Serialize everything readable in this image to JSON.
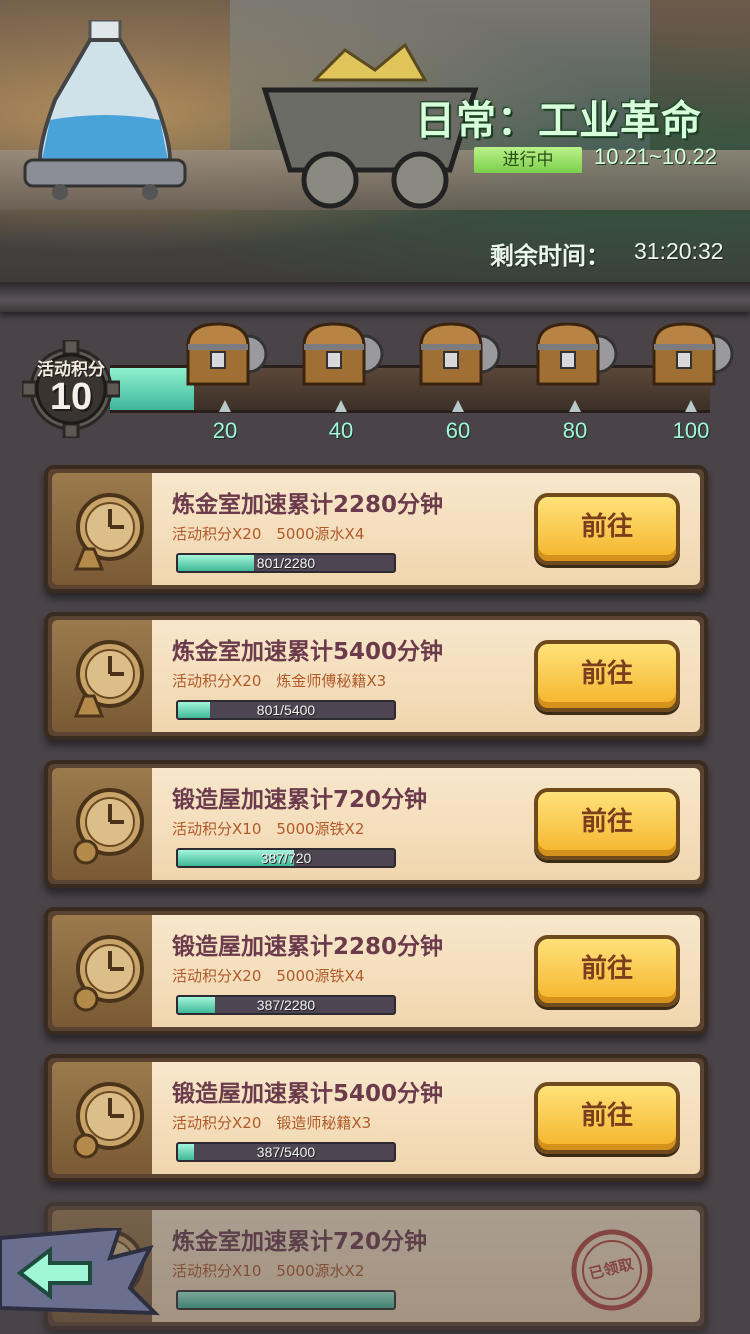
{
  "banner": {
    "title": "日常：工业革命",
    "status": "进行中",
    "date_range": "10.21~10.22",
    "time_label": "剩余时间：",
    "time_value": "31:20:32"
  },
  "points": {
    "label": "活动积分",
    "value": "10",
    "progress_fraction": 0.1,
    "milestones": [
      "20",
      "40",
      "60",
      "80",
      "100"
    ]
  },
  "tasks": [
    {
      "title": "炼金室加速累计2280分钟",
      "reward": "活动积分X20　5000源水X4",
      "progress_text": "801/2280",
      "progress": 0.351,
      "button": "前往",
      "icon": "clock-flask-icon"
    },
    {
      "title": "炼金室加速累计5400分钟",
      "reward": "活动积分X20　炼金师傅秘籍X3",
      "progress_text": "801/5400",
      "progress": 0.148,
      "button": "前往",
      "icon": "clock-flask-icon"
    },
    {
      "title": "锻造屋加速累计720分钟",
      "reward": "活动积分X10　5000源铁X2",
      "progress_text": "387/720",
      "progress": 0.5375,
      "button": "前往",
      "icon": "clock-gear-icon"
    },
    {
      "title": "锻造屋加速累计2280分钟",
      "reward": "活动积分X20　5000源铁X4",
      "progress_text": "387/2280",
      "progress": 0.17,
      "button": "前往",
      "icon": "clock-gear-icon"
    },
    {
      "title": "锻造屋加速累计5400分钟",
      "reward": "活动积分X20　锻造师秘籍X3",
      "progress_text": "387/5400",
      "progress": 0.072,
      "button": "前往",
      "icon": "clock-gear-icon"
    },
    {
      "title": "炼金室加速累计720分钟",
      "reward": "活动积分X10　5000源水X2",
      "progress_text": "",
      "progress": 1.0,
      "claimed_label": "已领取",
      "icon": "clock-flask-icon"
    }
  ],
  "colors": {
    "accent_green": "#9ff7d8",
    "button_yellow": "#f4b42a",
    "title_purple": "#6b3b4b"
  }
}
